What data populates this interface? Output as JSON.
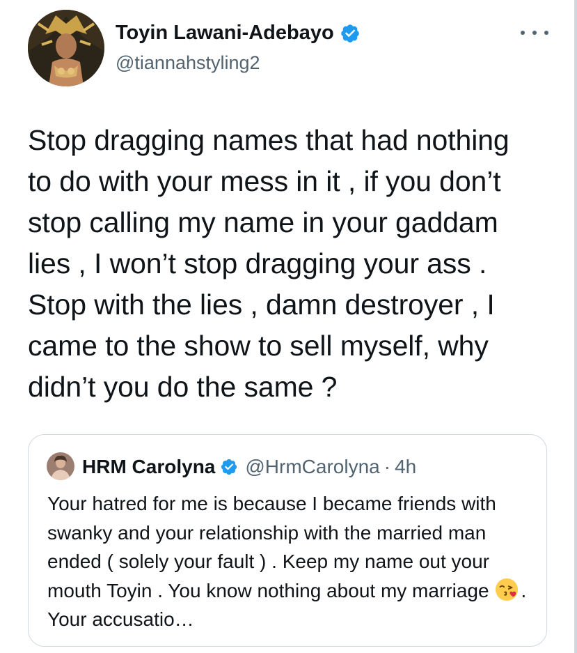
{
  "tweet": {
    "author": {
      "display_name": "Toyin Lawani-Adebayo",
      "handle": "@tiannahstyling2",
      "verified": true,
      "avatar_icon": "profile-photo"
    },
    "more_icon": "more-horizontal-icon",
    "text": "Stop dragging names that had nothing\nto do with your mess in it , if you don’t\nstop calling my name in your gaddam\nlies , I won’t stop dragging your ass .\nStop with the lies , damn destroyer , I\ncame to the show to sell myself, why\ndidn’t you do the same ?"
  },
  "quoted_tweet": {
    "author": {
      "display_name": "HRM Carolyna",
      "handle": "@HrmCarolyna",
      "verified": true
    },
    "separator": "·",
    "time": "4h",
    "text_before_emoji": "Your hatred for me is because I became friends with swanky and your relationship with the married man ended ( solely your fault ) . Keep my name out your mouth Toyin . You know nothing about my marriage",
    "emoji": "kissing-face-icon",
    "text_after_emoji": ". Your accusatio…"
  },
  "colors": {
    "text_primary": "#0f1419",
    "text_secondary": "#536471",
    "verified_blue": "#1d9bf0",
    "border": "#cfd9de"
  }
}
